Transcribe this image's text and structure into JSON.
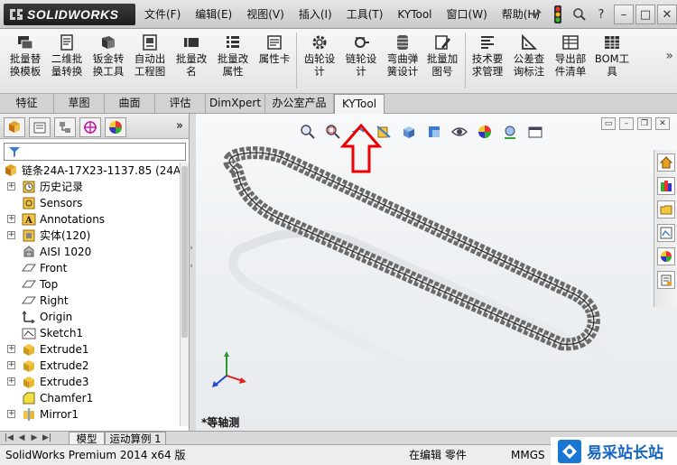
{
  "app": {
    "logo_text": "SOLIDWORKS",
    "accent": "#e00000"
  },
  "menu": {
    "items": [
      "文件(F)",
      "编辑(E)",
      "视图(V)",
      "插入(I)",
      "工具(T)",
      "KYTool",
      "窗口(W)",
      "帮助(H)"
    ]
  },
  "ribbon": {
    "buttons": [
      {
        "label1": "批量替",
        "label2": "换模板",
        "icon": "batch-replace-icon"
      },
      {
        "label1": "二维批",
        "label2": "量转换",
        "icon": "drawing-convert-icon"
      },
      {
        "label1": "钣金转",
        "label2": "换工具",
        "icon": "sheetmetal-icon"
      },
      {
        "label1": "自动出",
        "label2": "工程图",
        "icon": "auto-drawing-icon"
      },
      {
        "label1": "批量改",
        "label2": "名",
        "icon": "rename-icon"
      },
      {
        "label1": "批量改",
        "label2": "属性",
        "icon": "properties-icon"
      },
      {
        "label1": "属性卡",
        "label2": "",
        "icon": "property-card-icon"
      },
      {
        "label1": "齿轮设",
        "label2": "计",
        "icon": "gear-icon"
      },
      {
        "label1": "链轮设",
        "label2": "计",
        "icon": "sprocket-icon"
      },
      {
        "label1": "弯曲弹",
        "label2": "簧设计",
        "icon": "spring-icon"
      },
      {
        "label1": "批量加",
        "label2": "图号",
        "icon": "add-drawing-number-icon"
      },
      {
        "label1": "技术要",
        "label2": "求管理",
        "icon": "requirements-icon"
      },
      {
        "label1": "公差查",
        "label2": "询标注",
        "icon": "tolerance-icon"
      },
      {
        "label1": "导出部",
        "label2": "件清单",
        "icon": "export-list-icon"
      },
      {
        "label1": "BOM工",
        "label2": "具",
        "icon": "bom-icon"
      }
    ]
  },
  "tabs": [
    "特征",
    "草图",
    "曲面",
    "评估",
    "DimXpert",
    "办公室产品",
    "KYTool"
  ],
  "active_tab": "KYTool",
  "feature_tree": {
    "root": "链条24A-17X23-1137.85  (24A",
    "nodes": [
      {
        "label": "历史记录",
        "icon": "history-icon",
        "expandable": true
      },
      {
        "label": "Sensors",
        "icon": "sensor-icon",
        "expandable": false
      },
      {
        "label": "Annotations",
        "icon": "annotation-icon",
        "expandable": true
      },
      {
        "label": "实体(120)",
        "icon": "solid-bodies-icon",
        "expandable": true
      },
      {
        "label": "AISI 1020",
        "icon": "material-icon",
        "expandable": false
      },
      {
        "label": "Front",
        "icon": "plane-icon",
        "expandable": false
      },
      {
        "label": "Top",
        "icon": "plane-icon",
        "expandable": false
      },
      {
        "label": "Right",
        "icon": "plane-icon",
        "expandable": false
      },
      {
        "label": "Origin",
        "icon": "origin-icon",
        "expandable": false
      },
      {
        "label": "Sketch1",
        "icon": "sketch-icon",
        "expandable": false
      },
      {
        "label": "Extrude1",
        "icon": "extrude-icon",
        "expandable": true
      },
      {
        "label": "Extrude2",
        "icon": "extrude-icon",
        "expandable": true
      },
      {
        "label": "Extrude3",
        "icon": "extrude-icon",
        "expandable": true
      },
      {
        "label": "Chamfer1",
        "icon": "chamfer-icon",
        "expandable": false
      },
      {
        "label": "Mirror1",
        "icon": "mirror-icon",
        "expandable": true
      }
    ]
  },
  "bottom_tabs": [
    "模型",
    "运动算例 1"
  ],
  "viewport": {
    "view_label": "*等轴测"
  },
  "status": {
    "version": "SolidWorks Premium 2014 x64 版",
    "edit_state": "在编辑 零件",
    "units": "MMGS"
  },
  "watermark": {
    "text": "易采站长站"
  }
}
